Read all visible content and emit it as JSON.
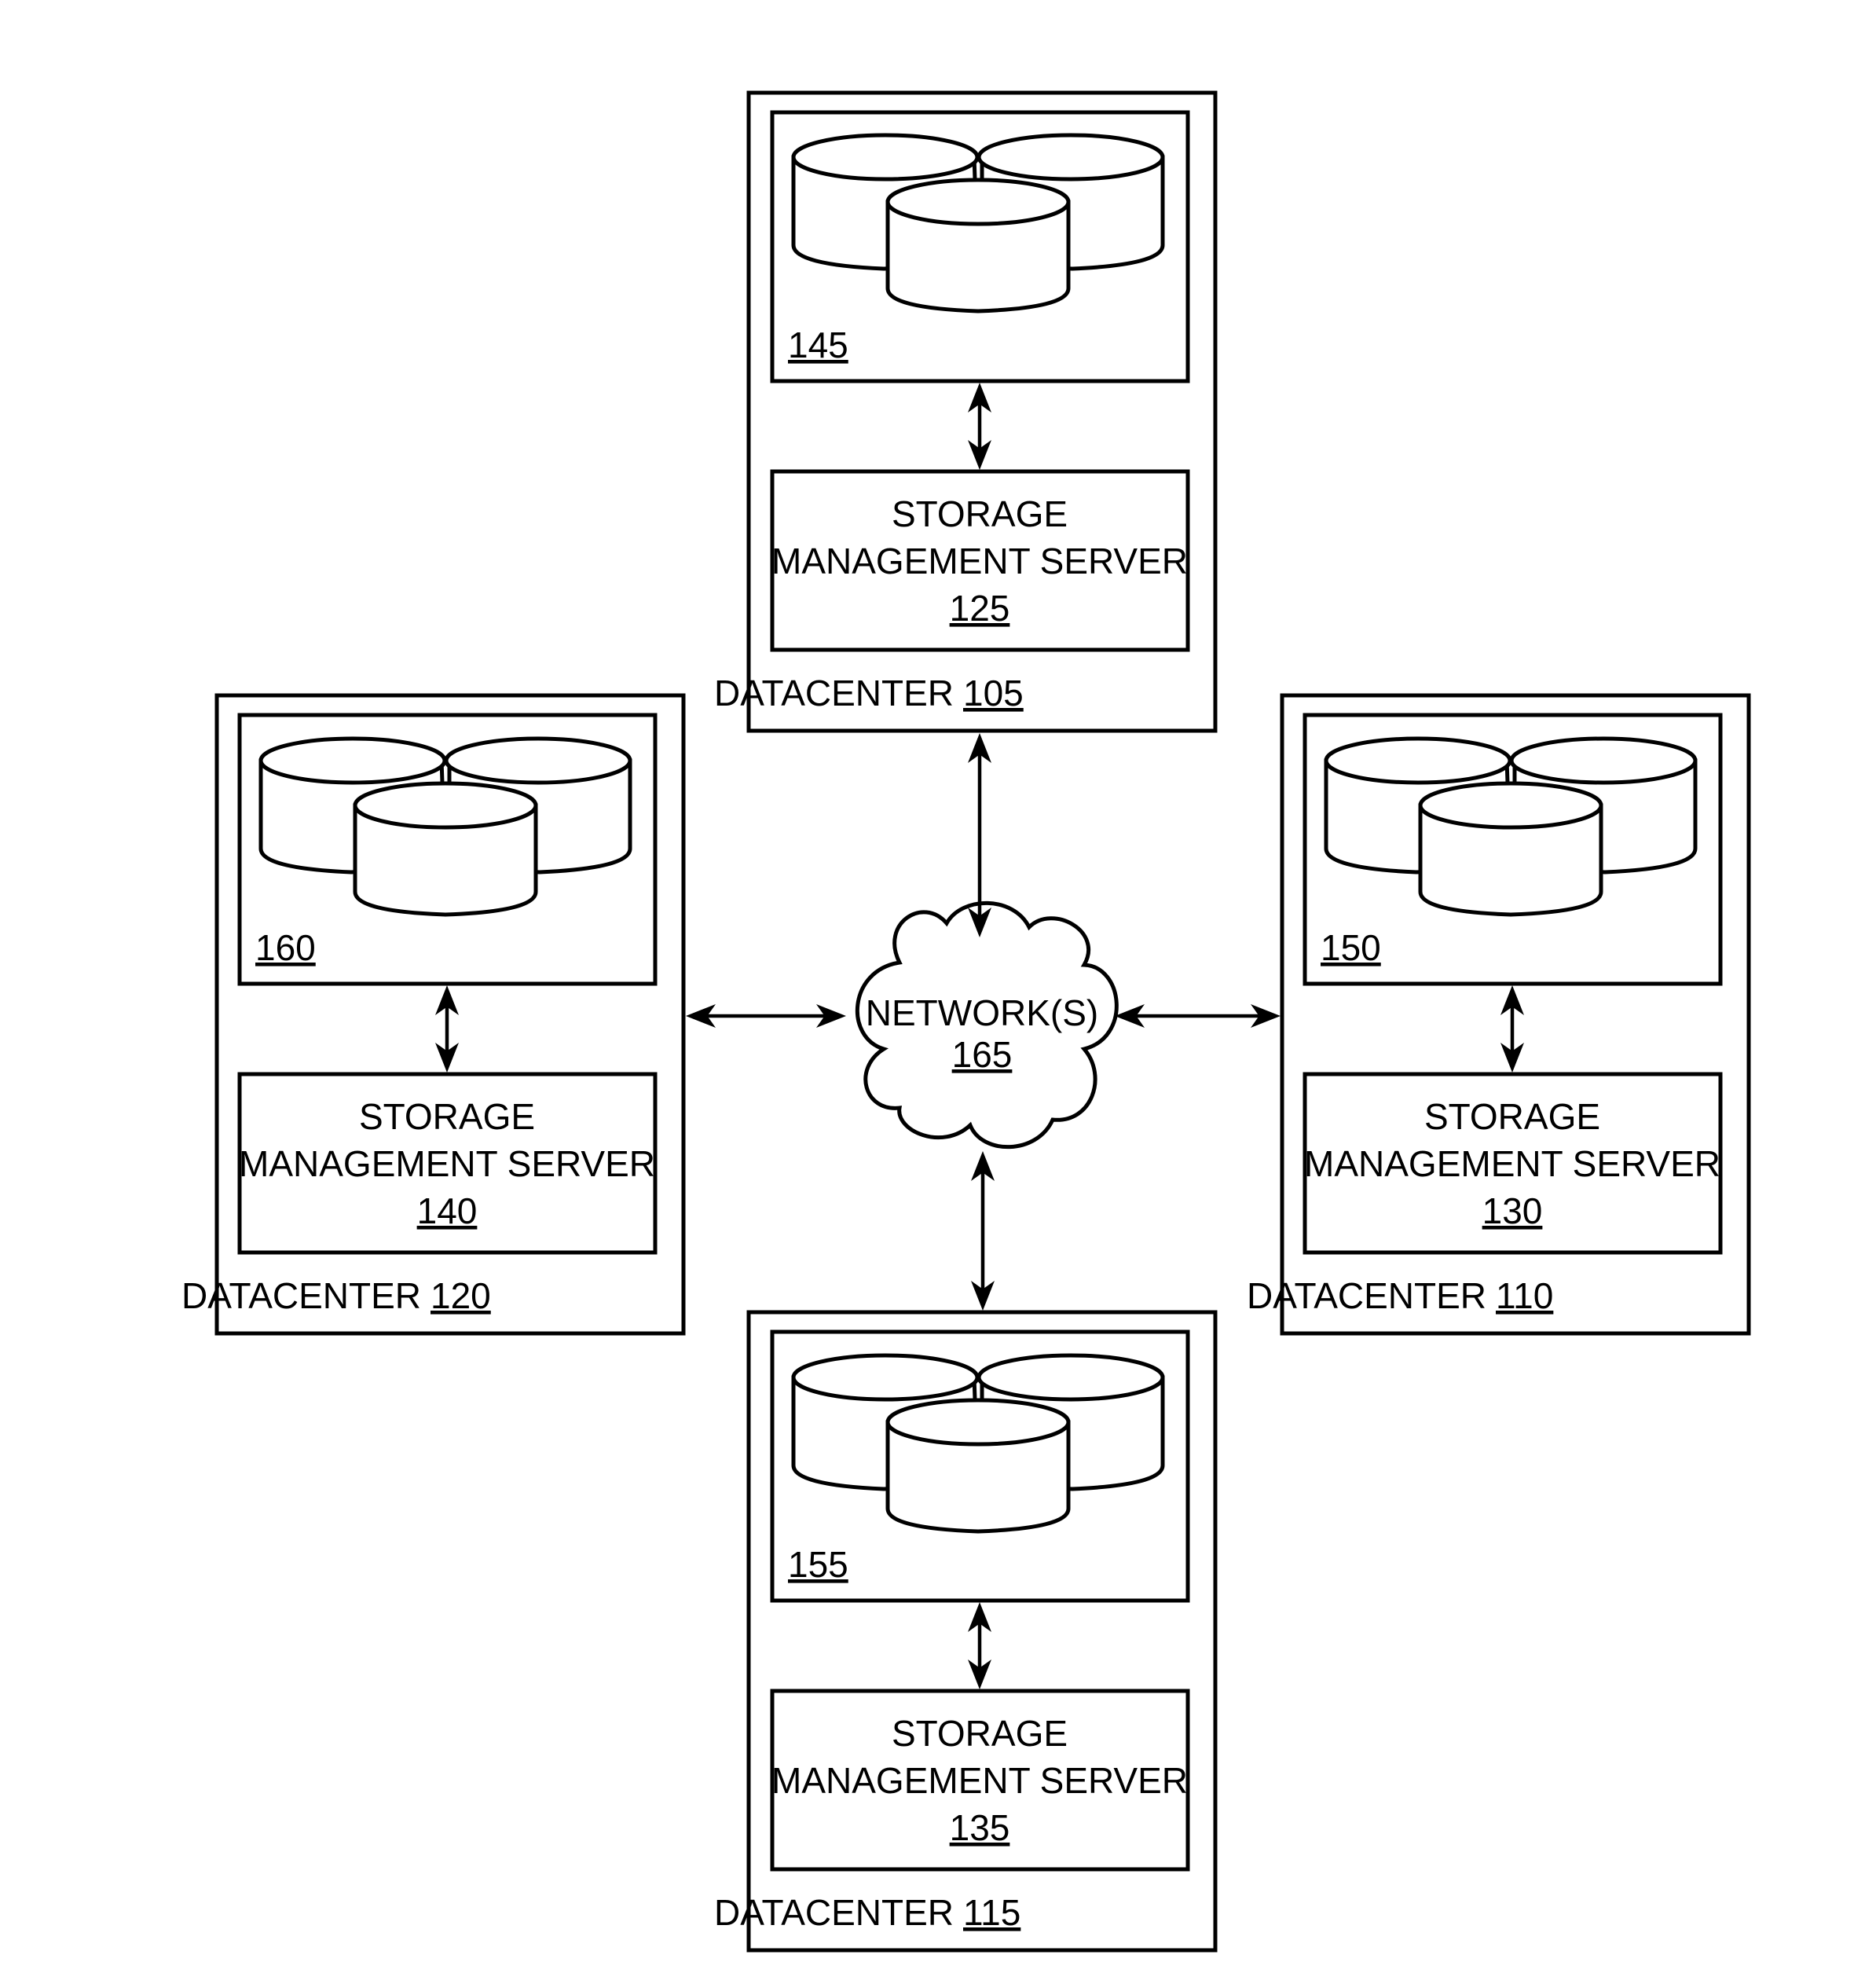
{
  "diagram": {
    "network": {
      "label": "NETWORK(S)",
      "ref": "165"
    },
    "datacenters": [
      {
        "id": "top",
        "label": "DATACENTER",
        "ref": "105",
        "storage_ref": "145",
        "server_label_line1": "STORAGE",
        "server_label_line2": "MANAGEMENT SERVER",
        "server_ref": "125"
      },
      {
        "id": "left",
        "label": "DATACENTER",
        "ref": "120",
        "storage_ref": "160",
        "server_label_line1": "STORAGE",
        "server_label_line2": "MANAGEMENT SERVER",
        "server_ref": "140"
      },
      {
        "id": "right",
        "label": "DATACENTER",
        "ref": "110",
        "storage_ref": "150",
        "server_label_line1": "STORAGE",
        "server_label_line2": "MANAGEMENT SERVER",
        "server_ref": "130"
      },
      {
        "id": "bottom",
        "label": "DATACENTER",
        "ref": "115",
        "storage_ref": "155",
        "server_label_line1": "STORAGE",
        "server_label_line2": "MANAGEMENT SERVER",
        "server_ref": "135"
      }
    ],
    "connections": [
      {
        "from": "DATACENTER 105",
        "to": "NETWORK(S) 165",
        "type": "bidirectional"
      },
      {
        "from": "DATACENTER 120",
        "to": "NETWORK(S) 165",
        "type": "bidirectional"
      },
      {
        "from": "DATACENTER 110",
        "to": "NETWORK(S) 165",
        "type": "bidirectional"
      },
      {
        "from": "DATACENTER 115",
        "to": "NETWORK(S) 165",
        "type": "bidirectional"
      },
      {
        "from": "145",
        "to": "125",
        "type": "bidirectional"
      },
      {
        "from": "160",
        "to": "140",
        "type": "bidirectional"
      },
      {
        "from": "150",
        "to": "130",
        "type": "bidirectional"
      },
      {
        "from": "155",
        "to": "135",
        "type": "bidirectional"
      }
    ]
  }
}
